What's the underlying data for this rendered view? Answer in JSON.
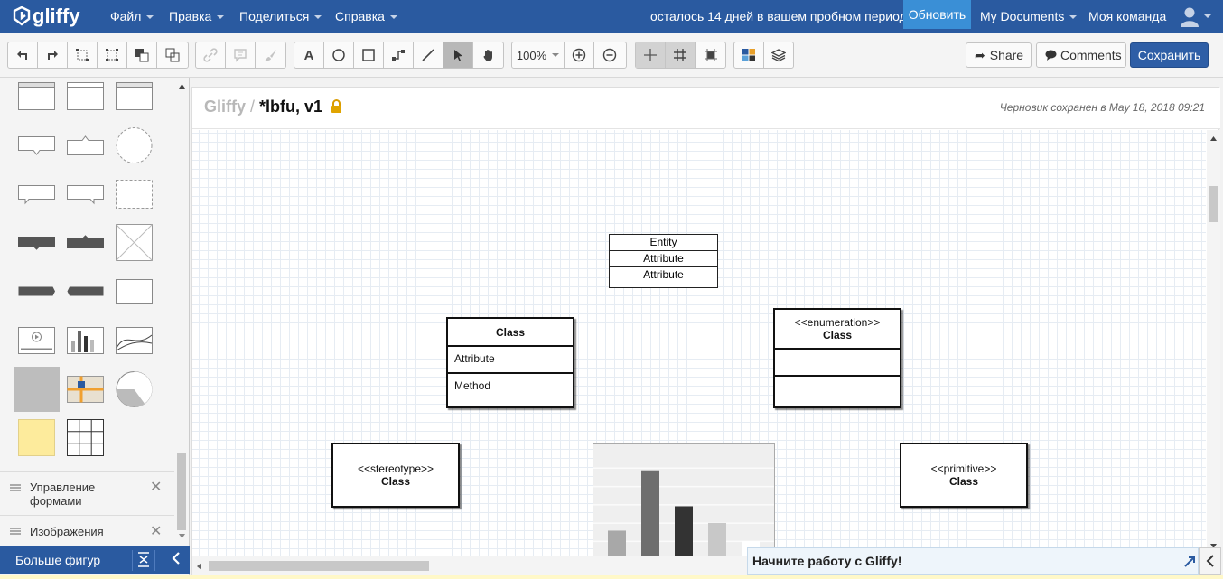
{
  "app": {
    "logo_text": "gliffy"
  },
  "topbar": {
    "menus": [
      "Файл",
      "Правка",
      "Поделиться",
      "Справка"
    ],
    "trial_text": "осталось 14 дней в вашем пробном периоде",
    "upgrade_label": "Обновить",
    "my_documents": "My Documents",
    "team": "Моя команда"
  },
  "toolbar": {
    "zoom": "100%",
    "share_label": "Share",
    "comments_label": "Comments",
    "save_label": "Сохранить",
    "text_tool": "A"
  },
  "left_panel": {
    "sections": [
      {
        "label": "Управление формами"
      },
      {
        "label": "Изображения"
      }
    ],
    "more_shapes_label": "Больше фигур"
  },
  "document": {
    "brand": "Gliffy",
    "separator": "/",
    "name": "*lbfu, v1",
    "status": "Черновик сохранен в May 18, 2018 09:21"
  },
  "diagram": {
    "entity": {
      "title": "Entity",
      "attributes": [
        "Attribute",
        "Attribute"
      ]
    },
    "class_box": {
      "name": "Class",
      "attribute": "Attribute",
      "method": "Method"
    },
    "enumeration_box": {
      "stereotype": "<<enumeration>>",
      "name": "Class"
    },
    "stereotype_box": {
      "stereotype": "<<stereotype>>",
      "name": "Class"
    },
    "primitive_box": {
      "stereotype": "<<primitive>>",
      "name": "Class"
    },
    "bar_chart": {
      "values": [
        0.37,
        0.84,
        0.56,
        0.43,
        0.29
      ],
      "colors": [
        "#a8a8a8",
        "#6e6e6e",
        "#333333",
        "#c8c8c8",
        "#ffffff"
      ]
    }
  },
  "get_started": {
    "label": "Начните работу с Gliffy!"
  },
  "colors": {
    "nav": "#2a5aa0",
    "upgrade": "#3a8fd6",
    "save": "#2e5ea6"
  }
}
